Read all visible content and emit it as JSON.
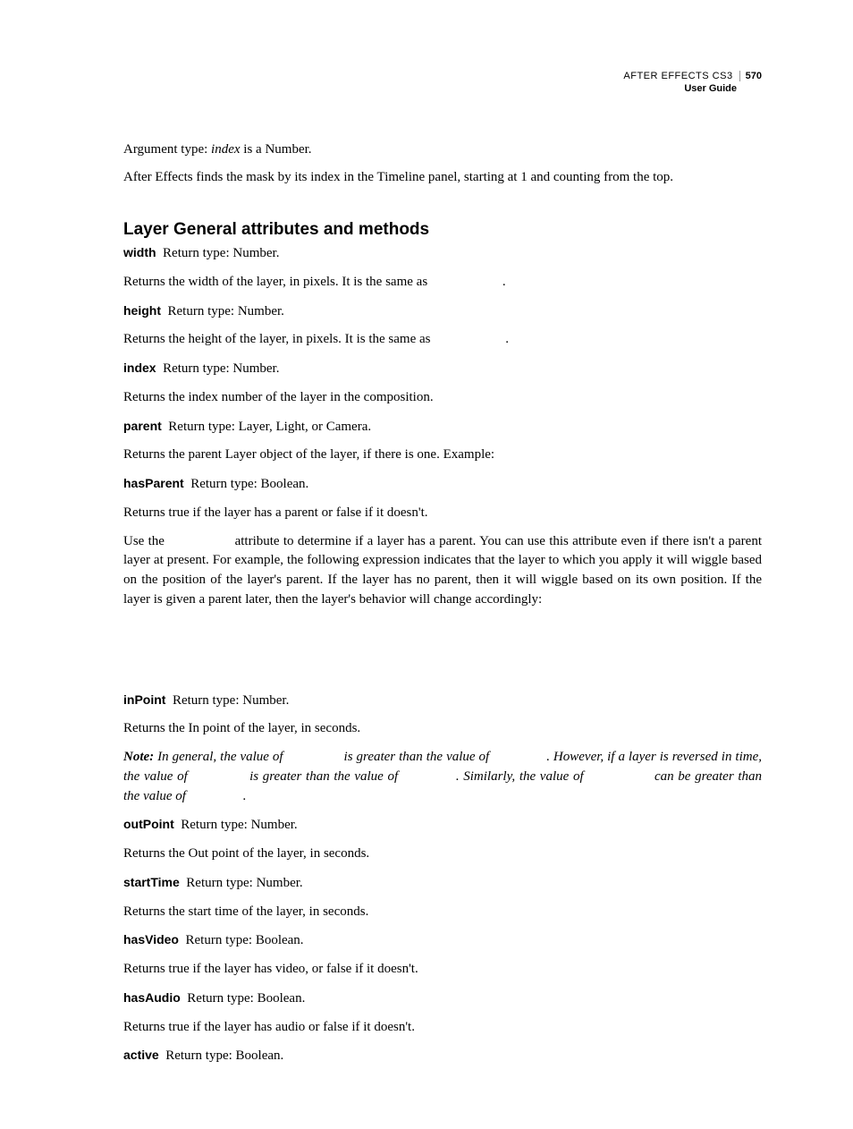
{
  "header": {
    "product": "AFTER EFFECTS CS3",
    "page_number": "570",
    "subtitle": "User Guide"
  },
  "intro": {
    "p1_a": "Argument type: ",
    "p1_b": "index",
    "p1_c": " is a Number.",
    "p2": "After Effects finds the mask by its index in the Timeline panel, starting at 1 and counting from the top."
  },
  "section_title": "Layer General attributes and methods",
  "entries": {
    "width_term": "width",
    "width_ret": "Return type: Number.",
    "width_desc_a": "Returns the width of the layer, in pixels. It is the same as ",
    "width_desc_b": ".",
    "height_term": "height",
    "height_ret": "Return type: Number.",
    "height_desc_a": "Returns the height of the layer, in pixels. It is the same as ",
    "height_desc_b": ".",
    "index_term": "index",
    "index_ret": "Return type: Number.",
    "index_desc": "Returns the index number of the layer in the composition.",
    "parent_term": "parent",
    "parent_ret": "Return type: Layer, Light, or Camera.",
    "parent_desc": "Returns the parent Layer object of the layer, if there is one. Example: ",
    "hasParent_term": "hasParent",
    "hasParent_ret": "Return type: Boolean.",
    "hasParent_desc": "Returns true if the layer has a parent or false if it doesn't.",
    "hasParent_para_a": "Use the ",
    "hasParent_para_b": " attribute to determine if a layer has a parent. You can use this attribute even if there isn't a parent layer at present. For example, the following expression indicates that the layer to which you apply it will wiggle based on the position of the layer's parent. If the layer has no parent, then it will wiggle based on its own position. If the layer is given a parent later, then the layer's behavior will change accordingly:",
    "inPoint_term": "inPoint",
    "inPoint_ret": "Return type: Number.",
    "inPoint_desc": "Returns the In point of the layer, in seconds.",
    "note_label": "Note:",
    "note_a": " In general, the value of ",
    "note_b": " is greater than the value of ",
    "note_c": ". However, if a layer is reversed in time, the value of ",
    "note_d": " is greater than the value of ",
    "note_e": ". Similarly, the value of ",
    "note_f": " can be greater than the value of ",
    "note_g": ".",
    "outPoint_term": "outPoint",
    "outPoint_ret": "Return type: Number.",
    "outPoint_desc": "Returns the Out point of the layer, in seconds.",
    "startTime_term": "startTime",
    "startTime_ret": "Return type: Number.",
    "startTime_desc": "Returns the start time of the layer, in seconds.",
    "hasVideo_term": "hasVideo",
    "hasVideo_ret": "Return type: Boolean.",
    "hasVideo_desc": "Returns true if the layer has video, or false if it doesn't.",
    "hasAudio_term": "hasAudio",
    "hasAudio_ret": "Return type: Boolean.",
    "hasAudio_desc": "Returns true if the layer has audio or false if it doesn't.",
    "active_term": "active",
    "active_ret": "Return type: Boolean."
  }
}
